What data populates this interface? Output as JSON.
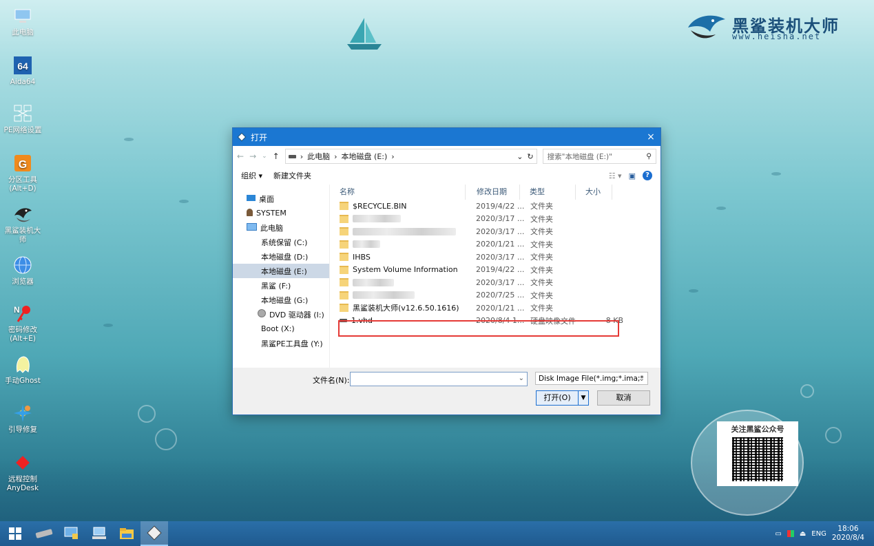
{
  "desktop": {
    "icons": [
      {
        "label": "此电脑",
        "icon": "computer-icon"
      },
      {
        "label": "Aida64",
        "icon": "aida64-icon"
      },
      {
        "label": "PE网络设置",
        "icon": "network-icon"
      },
      {
        "label": "分区工具\n(Alt+D)",
        "icon": "partition-tool-icon"
      },
      {
        "label": "黑鲨装机大\n师",
        "icon": "heisha-shark-icon"
      },
      {
        "label": "浏览器",
        "icon": "browser-globe-icon"
      },
      {
        "label": "密码修改\n(Alt+E)",
        "icon": "password-key-icon"
      },
      {
        "label": "手动Ghost",
        "icon": "ghost-icon"
      },
      {
        "label": "引导修复",
        "icon": "boot-repair-icon"
      },
      {
        "label": "远程控制\nAnyDesk",
        "icon": "anydesk-icon"
      }
    ]
  },
  "logo": {
    "name": "黑鲨装机大师",
    "url": "www.heisha.net"
  },
  "qr": {
    "title": "关注黑鲨公众号"
  },
  "dialog": {
    "title": "打开",
    "close": "×",
    "address": {
      "crumbs": [
        "此电脑",
        "本地磁盘 (E:)"
      ]
    },
    "search_placeholder": "搜索\"本地磁盘 (E:)\"",
    "toolbar": {
      "organize": "组织 ▾",
      "new_folder": "新建文件夹"
    },
    "nav": [
      {
        "label": "桌面",
        "indent": false,
        "selected": false,
        "icon": "desktop-icon"
      },
      {
        "label": "SYSTEM",
        "indent": false,
        "selected": false,
        "icon": "user-icon"
      },
      {
        "label": "此电脑",
        "indent": false,
        "selected": false,
        "icon": "computer-icon"
      },
      {
        "label": "系统保留 (C:)",
        "indent": true,
        "selected": false,
        "icon": "drive-icon"
      },
      {
        "label": "本地磁盘 (D:)",
        "indent": true,
        "selected": false,
        "icon": "drive-icon"
      },
      {
        "label": "本地磁盘 (E:)",
        "indent": true,
        "selected": true,
        "icon": "drive-icon"
      },
      {
        "label": "黑鲨 (F:)",
        "indent": true,
        "selected": false,
        "icon": "drive-icon"
      },
      {
        "label": "本地磁盘 (G:)",
        "indent": true,
        "selected": false,
        "icon": "drive-icon"
      },
      {
        "label": "DVD 驱动器 (I:)",
        "indent": true,
        "selected": false,
        "icon": "dvd-icon"
      },
      {
        "label": "Boot (X:)",
        "indent": true,
        "selected": false,
        "icon": "drive-icon"
      },
      {
        "label": "黑鲨PE工具盘 (Y:)",
        "indent": true,
        "selected": false,
        "icon": "drive-icon"
      }
    ],
    "columns": [
      "名称",
      "修改日期",
      "类型",
      "大小"
    ],
    "files": [
      {
        "name": "$RECYCLE.BIN",
        "date": "2019/4/22 ...",
        "type": "文件夹",
        "size": "",
        "kind": "folder",
        "blurred": false
      },
      {
        "name": "",
        "date": "2020/3/17 ...",
        "type": "文件夹",
        "size": "",
        "kind": "folder",
        "blurred": true
      },
      {
        "name": "",
        "date": "2020/3/17 ...",
        "type": "文件夹",
        "size": "",
        "kind": "folder",
        "blurred": true
      },
      {
        "name": "",
        "date": "2020/1/21 ...",
        "type": "文件夹",
        "size": "",
        "kind": "folder",
        "blurred": true
      },
      {
        "name": "IHBS",
        "date": "2020/3/17 ...",
        "type": "文件夹",
        "size": "",
        "kind": "folder",
        "blurred": false
      },
      {
        "name": "System Volume Information",
        "date": "2019/4/22 ...",
        "type": "文件夹",
        "size": "",
        "kind": "folder",
        "blurred": false
      },
      {
        "name": "",
        "date": "2020/3/17 ...",
        "type": "文件夹",
        "size": "",
        "kind": "folder",
        "blurred": true
      },
      {
        "name": "",
        "date": "2020/7/25 ...",
        "type": "文件夹",
        "size": "",
        "kind": "folder",
        "blurred": true
      },
      {
        "name": "黑鲨装机大师(v12.6.50.1616)",
        "date": "2020/1/21 ...",
        "type": "文件夹",
        "size": "",
        "kind": "folder",
        "blurred": false
      },
      {
        "name": "1.vhd",
        "date": "2020/8/4 1...",
        "type": "硬盘映像文件",
        "size": "8 KB",
        "kind": "vhd",
        "blurred": false
      }
    ],
    "filename_label": "文件名(N):",
    "filename_value": "",
    "filetype": "Disk Image File(*.img;*.ima;*",
    "open_button": "打开(O)",
    "cancel_button": "取消"
  },
  "taskbar": {
    "lang": "ENG",
    "time": "18:06",
    "date": "2020/8/4"
  }
}
